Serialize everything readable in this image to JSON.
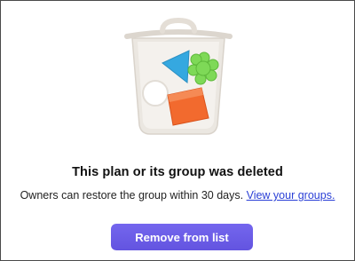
{
  "state": {
    "heading": "This plan or its group was deleted",
    "message": "Owners can restore the group within 30 days.",
    "link_label": "View your groups."
  },
  "actions": {
    "remove_label": "Remove from list"
  },
  "illustration": {
    "icon": "trash-bin-icon",
    "colors": {
      "bin": "#e8e4de",
      "triangle": "#35a8e0",
      "flower": "#7ed957",
      "block": "#f26a2e",
      "button": "#6c5ce7"
    }
  }
}
